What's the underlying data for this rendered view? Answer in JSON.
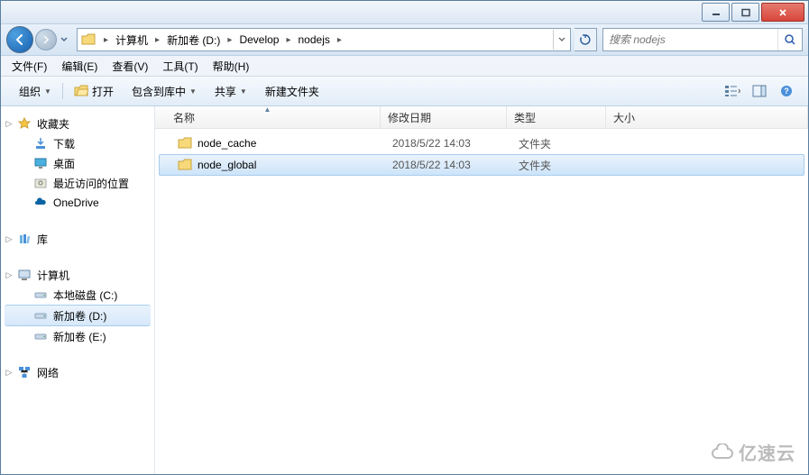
{
  "titlebar": {},
  "address": {
    "segments": [
      "计算机",
      "新加卷 (D:)",
      "Develop",
      "nodejs"
    ]
  },
  "search": {
    "placeholder": "搜索 nodejs"
  },
  "menu": {
    "file": "文件(F)",
    "edit": "编辑(E)",
    "view": "查看(V)",
    "tools": "工具(T)",
    "help": "帮助(H)"
  },
  "toolbar": {
    "organize": "组织",
    "open": "打开",
    "include": "包含到库中",
    "share": "共享",
    "newfolder": "新建文件夹"
  },
  "columns": {
    "name": "名称",
    "date": "修改日期",
    "type": "类型",
    "size": "大小"
  },
  "nav": {
    "favorites": "收藏夹",
    "downloads": "下载",
    "desktop": "桌面",
    "recent": "最近访问的位置",
    "onedrive": "OneDrive",
    "libraries": "库",
    "computer": "计算机",
    "drive_c": "本地磁盘 (C:)",
    "drive_d": "新加卷 (D:)",
    "drive_e": "新加卷 (E:)",
    "network": "网络"
  },
  "files": [
    {
      "name": "node_cache",
      "date": "2018/5/22 14:03",
      "type": "文件夹",
      "selected": false
    },
    {
      "name": "node_global",
      "date": "2018/5/22 14:03",
      "type": "文件夹",
      "selected": true
    }
  ],
  "watermark": "亿速云"
}
